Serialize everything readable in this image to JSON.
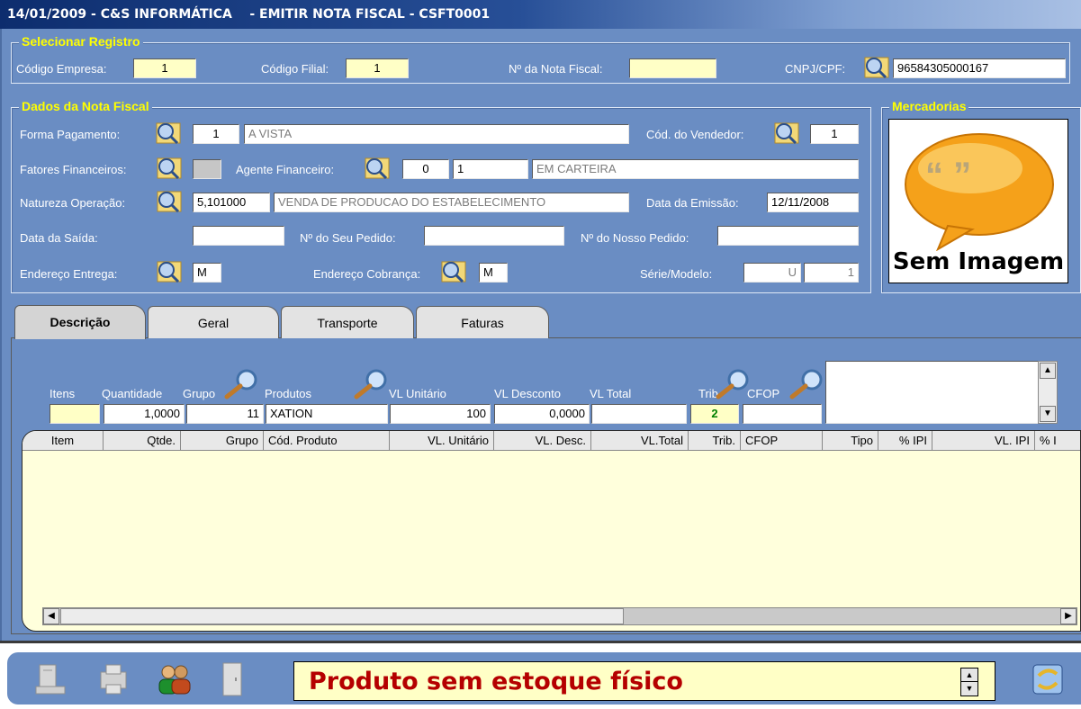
{
  "window": {
    "title": "14/01/2009 - C&S INFORMÁTICA    - EMITIR NOTA FISCAL - CSFT0001"
  },
  "colors": {
    "form_bg": "#6a8dc3",
    "legend": "#ffff00",
    "highlight_field": "#ffffc6",
    "grid_bg": "#ffffdc",
    "message_text": "#b50000"
  },
  "select": {
    "legend": "Selecionar Registro",
    "empresa_label": "Código Empresa:",
    "empresa_value": "1",
    "filial_label": "Código Filial:",
    "filial_value": "1",
    "nota_label": "Nº da Nota Fiscal:",
    "nota_value": "",
    "cnpj_label": "CNPJ/CPF:",
    "cnpj_value": "96584305000167"
  },
  "dados": {
    "legend": "Dados da Nota Fiscal",
    "forma_label": "Forma  Pagamento:",
    "forma_code": "1",
    "forma_desc": "A VISTA",
    "vendedor_label": "Cód. do Vendedor:",
    "vendedor_value": "1",
    "fatores_label": "Fatores Financeiros:",
    "agente_label": "Agente Financeiro:",
    "agente_code1": "0",
    "agente_code2": "1",
    "agente_desc": "EM CARTEIRA",
    "natureza_label": "Natureza Operação:",
    "natureza_code": "5,101000",
    "natureza_desc": "VENDA DE PRODUCAO DO ESTABELECIMENTO",
    "emissao_label": "Data da  Emissão:",
    "emissao_value": "12/11/2008",
    "saida_label": "Data da Saída:",
    "saida_value": "",
    "seu_pedido_label": "Nº do Seu Pedido:",
    "seu_pedido_value": "",
    "nosso_pedido_label": "Nº do Nosso Pedido:",
    "nosso_pedido_value": "",
    "entrega_label": "Endereço  Entrega:",
    "entrega_value": "M",
    "cobranca_label": "Endereço Cobrança:",
    "cobranca_value": "M",
    "serie_label": "Série/Modelo:",
    "serie_value": "U",
    "modelo_value": "1"
  },
  "mercadorias": {
    "legend": "Mercadorias",
    "image_text": "Sem Imagem",
    "quote_glyphs": "“ ”"
  },
  "tabs": [
    {
      "label": "Descrição"
    },
    {
      "label": "Geral"
    },
    {
      "label": "Transporte"
    },
    {
      "label": "Faturas"
    }
  ],
  "entry": {
    "itens_label": "Itens",
    "quantidade_label": "Quantidade",
    "grupo_label": "Grupo",
    "produtos_label": "Produtos",
    "vl_unitario_label": "VL Unitário",
    "vl_desconto_label": "VL Desconto",
    "vl_total_label": "VL Total",
    "trib_label": "Trib.",
    "cfop_label": "CFOP",
    "itens_value": "",
    "quantidade_value": "1,0000",
    "grupo_value": "11",
    "produto_value": "XATION",
    "vl_unitario_value": "100",
    "vl_desconto_value": "0,0000",
    "vl_total_value": "",
    "trib_value": "2",
    "cfop_value": ""
  },
  "grid": {
    "columns": [
      "Item",
      "Qtde.",
      "Grupo",
      "Cód. Produto",
      "VL. Unitário",
      "VL. Desc.",
      "VL.Total",
      "Trib.",
      "CFOP",
      "Tipo",
      "% IPI",
      "VL. IPI",
      "% I"
    ],
    "rows": []
  },
  "footer": {
    "message": "Produto sem estoque físico"
  }
}
